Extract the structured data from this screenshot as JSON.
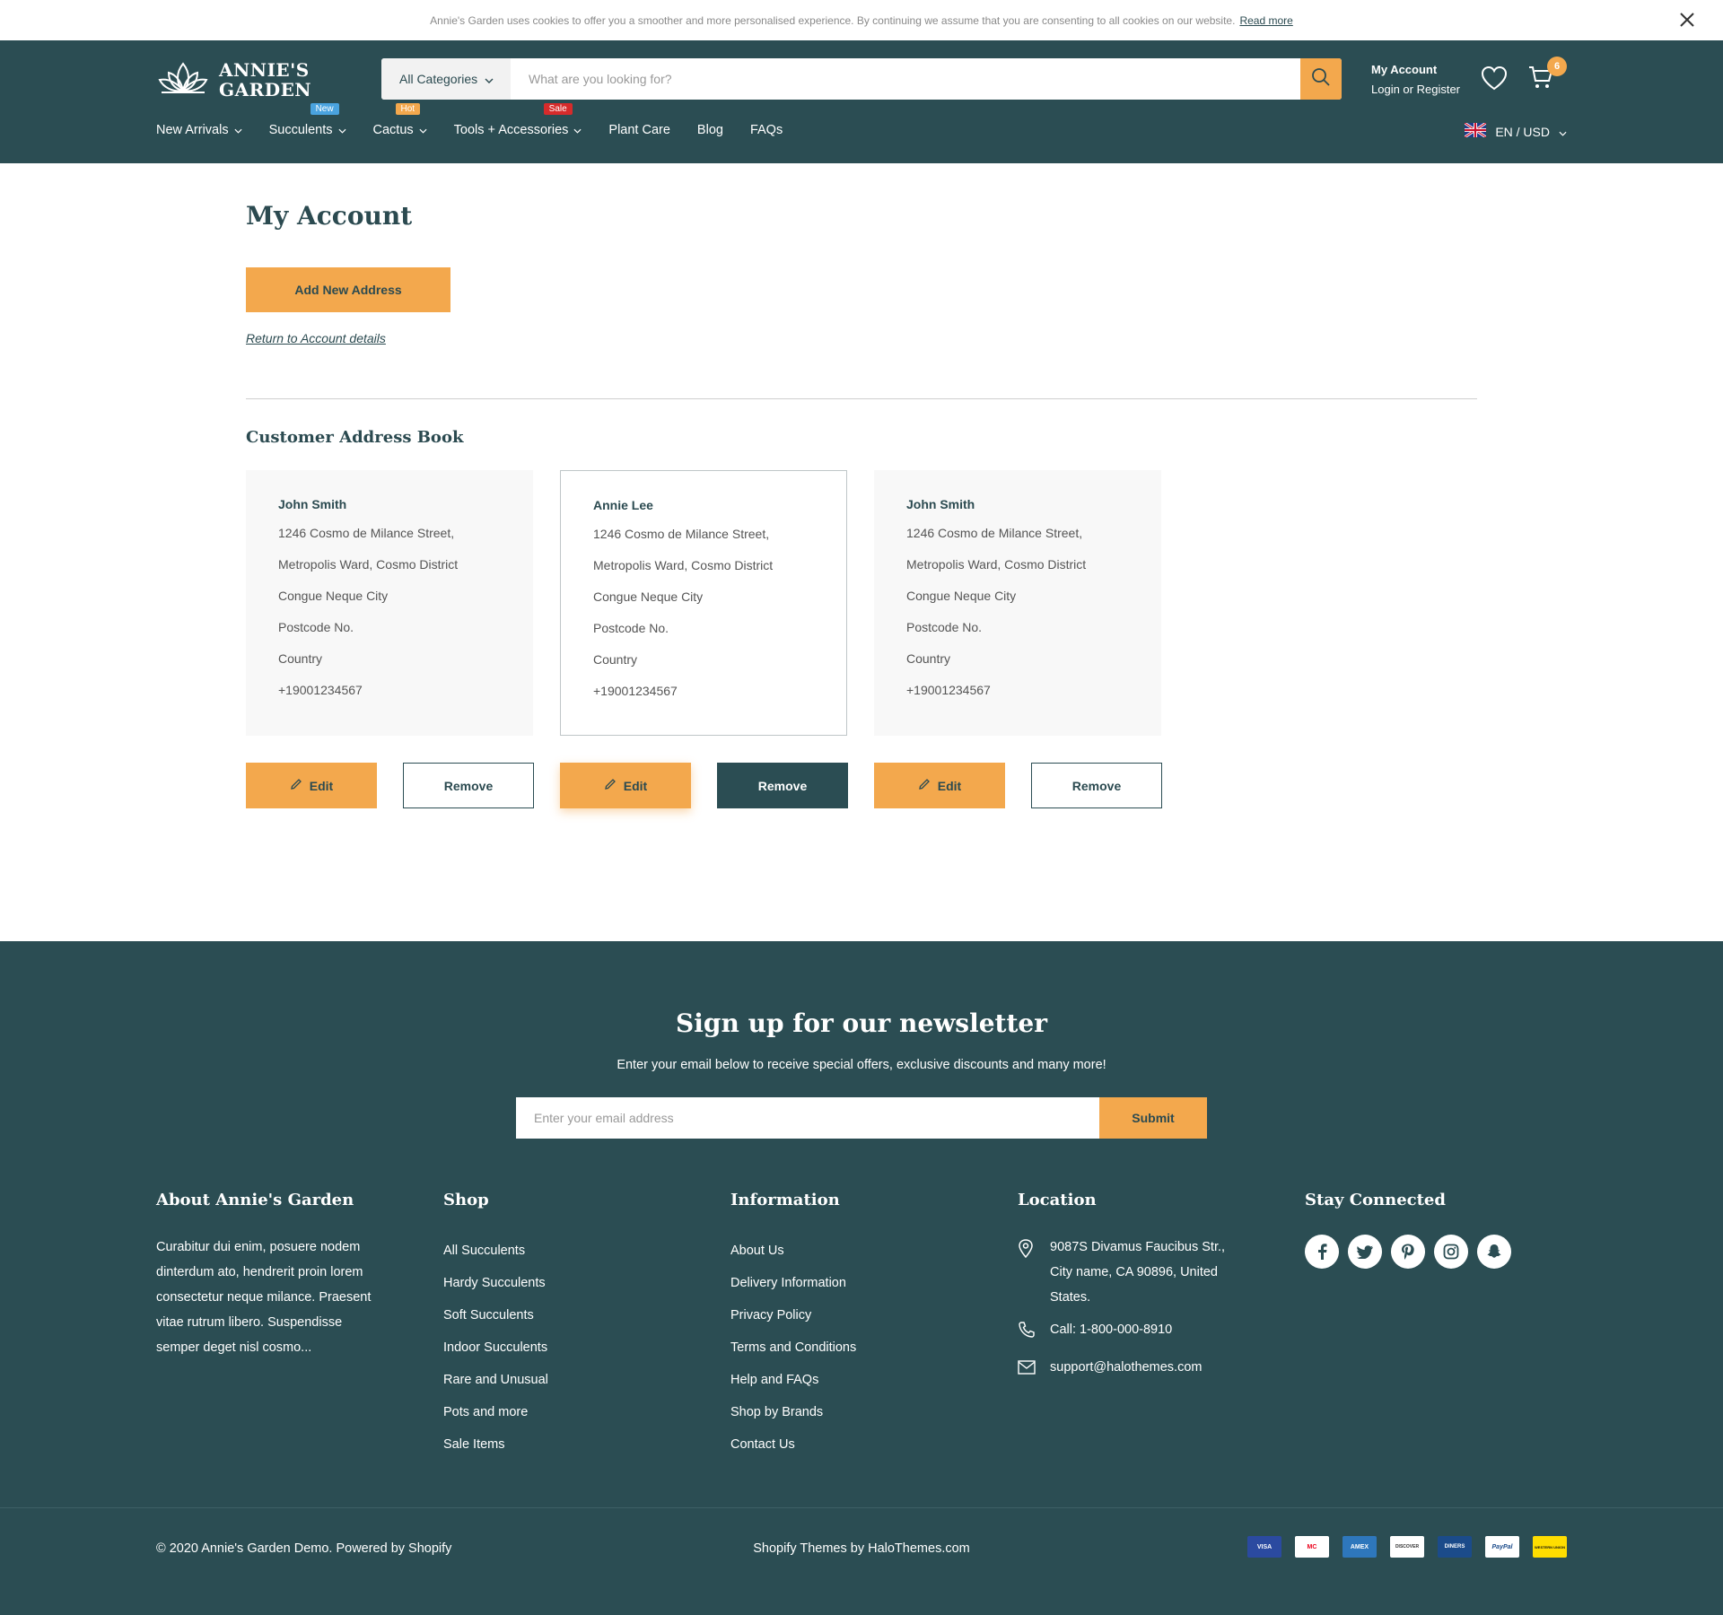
{
  "cookie": {
    "text": "Annie's Garden uses cookies to offer you a smoother and more personalised experience. By continuing we assume that you are consenting to all cookies on our website.",
    "link": "Read more"
  },
  "header": {
    "logo_line1": "ANNIE'S",
    "logo_line2": "GARDEN",
    "search_category": "All Categories",
    "search_placeholder": "What are you looking for?",
    "account_title": "My Account",
    "account_sub": "Login or Register",
    "cart_count": "6",
    "lang": "EN / USD"
  },
  "nav": [
    {
      "label": "New Arrivals"
    },
    {
      "label": "Succulents",
      "badge": "New",
      "badge_color": "#4aa3df"
    },
    {
      "label": "Cactus",
      "badge": "Hot",
      "badge_color": "#f3a84d"
    },
    {
      "label": "Tools + Accessories",
      "badge": "Sale",
      "badge_color": "#d62b2b"
    },
    {
      "label": "Plant Care"
    },
    {
      "label": "Blog"
    },
    {
      "label": "FAQs"
    }
  ],
  "main": {
    "title": "My Account",
    "add_button": "Add New Address",
    "return_link": "Return to Account details",
    "book_title": "Customer Address Book",
    "addresses": [
      {
        "name": "John Smith",
        "line1": "1246 Cosmo de Milance Street,",
        "line2": "Metropolis Ward, Cosmo District",
        "city": "Congue Neque City",
        "postcode": "Postcode No.",
        "country": "Country",
        "phone": "+19001234567"
      },
      {
        "name": "Annie Lee",
        "line1": "1246 Cosmo de Milance Street,",
        "line2": "Metropolis Ward, Cosmo District",
        "city": "Congue Neque City",
        "postcode": "Postcode No.",
        "country": "Country",
        "phone": "+19001234567"
      },
      {
        "name": "John Smith",
        "line1": "1246 Cosmo de Milance Street,",
        "line2": "Metropolis Ward, Cosmo District",
        "city": "Congue Neque City",
        "postcode": "Postcode No.",
        "country": "Country",
        "phone": "+19001234567"
      }
    ],
    "edit_label": "Edit",
    "remove_label": "Remove"
  },
  "footer": {
    "newsletter_title": "Sign up for our newsletter",
    "newsletter_sub": "Enter your email below to receive special offers, exclusive discounts and many more!",
    "email_placeholder": "Enter your email address",
    "submit": "Submit",
    "about_title": "About Annie's Garden",
    "about_text": "Curabitur dui enim, posuere nodem dinterdum ato, hendrerit proin lorem consectetur neque milance. Praesent vitae rutrum libero. Suspendisse semper deget nisl cosmo...",
    "shop_title": "Shop",
    "shop_links": [
      "All Succulents",
      "Hardy Succulents",
      "Soft Succulents",
      "Indoor Succulents",
      "Rare and Unusual",
      "Pots and more",
      "Sale Items"
    ],
    "info_title": "Information",
    "info_links": [
      "About Us",
      "Delivery Information",
      "Privacy Policy",
      "Terms and Conditions",
      "Help and FAQs",
      "Shop by Brands",
      "Contact Us"
    ],
    "location_title": "Location",
    "address": "9087S Divamus Faucibus Str., City name, CA 90896, United States.",
    "phone": "Call: 1-800-000-8910",
    "email": "support@halothemes.com",
    "social_title": "Stay Connected",
    "copyright": "© 2020 Annie's Garden Demo. Powered by Shopify",
    "credit": "Shopify Themes by HaloThemes.com",
    "payments": [
      "VISA",
      "MC",
      "AMEX",
      "DISCOVER",
      "DINERS",
      "PayPal",
      "WESTERN UNION"
    ]
  },
  "colors": {
    "brand": "#2b4d53",
    "accent": "#f3a84d"
  }
}
